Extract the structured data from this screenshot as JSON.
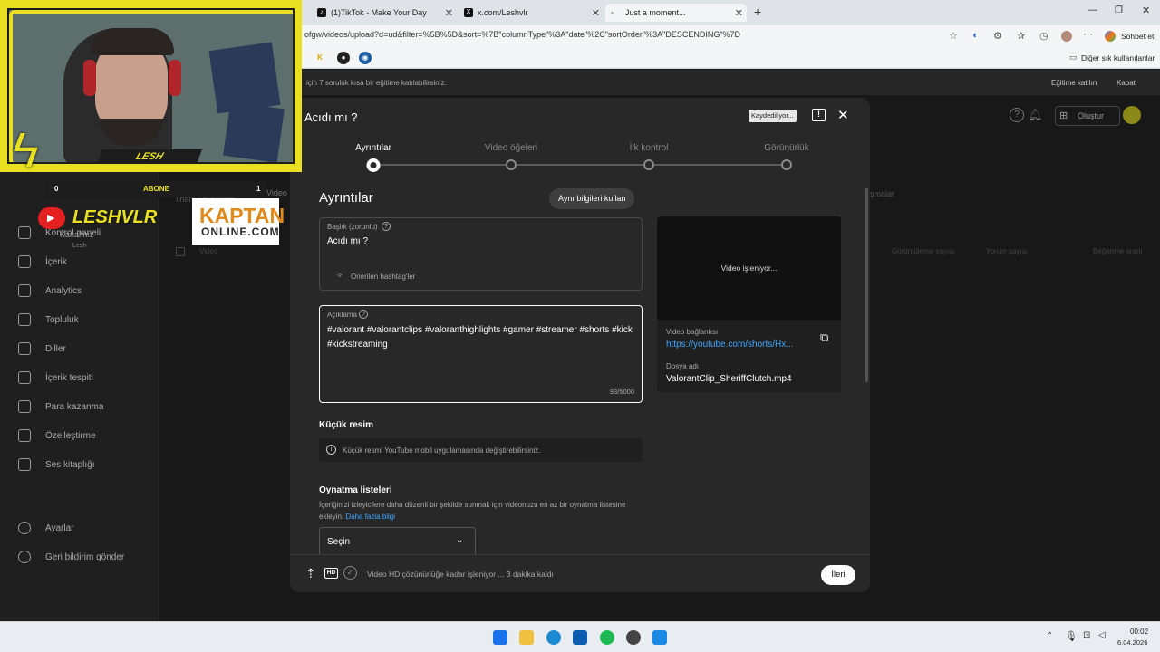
{
  "browser": {
    "tabs": [
      {
        "label": "(1)TikTok - Make Your Day"
      },
      {
        "label": "x.com/Leshvlr"
      },
      {
        "label": "Just a moment..."
      }
    ],
    "url": "ofgw/videos/upload?d=ud&filter=%5B%5D&sort=%7B\"columnType\"%3A\"date\"%2C\"sortOrder\"%3A\"DESCENDING\"%7D",
    "copilot_label": "Sohbet et",
    "bookmarks_other": "Diğer sık kullanılanlar"
  },
  "banner": {
    "text": "için 7 soruluk kısa bir eğitime katılabilirsiniz.",
    "join": "Eğitime katılın",
    "close": "Kapat"
  },
  "header": {
    "create": "Oluştur"
  },
  "channel": {
    "label": "Kanalınız",
    "name": "Lesh"
  },
  "sidebar": {
    "items": [
      {
        "label": "Kontrol paneli",
        "icon": "dashboard-icon"
      },
      {
        "label": "İçerik",
        "icon": "content-icon"
      },
      {
        "label": "Analytics",
        "icon": "analytics-icon"
      },
      {
        "label": "Topluluk",
        "icon": "community-icon"
      },
      {
        "label": "Diller",
        "icon": "subtitles-icon"
      },
      {
        "label": "İçerik tespiti",
        "icon": "copyright-icon"
      },
      {
        "label": "Para kazanma",
        "icon": "dollar-icon"
      },
      {
        "label": "Özelleştirme",
        "icon": "magic-icon"
      },
      {
        "label": "Ses kitaplığı",
        "icon": "audio-library-icon"
      }
    ],
    "bottom": [
      {
        "label": "Ayarlar",
        "icon": "gear-icon"
      },
      {
        "label": "Geri bildirim gönder",
        "icon": "feedback-icon"
      }
    ]
  },
  "page_bg": {
    "tab_video": "Video",
    "tab_inspiration": "İlham kaynakları",
    "col_playlists": "işmalar",
    "col_views": "Görüntüleme sayısı",
    "col_comments": "Yorum sayısı",
    "col_likes": "Beğenme oranı",
    "video_label": "Video"
  },
  "modal": {
    "title": "Acıdı mı ?",
    "saving": "Kaydediliyor...",
    "steps": [
      "Ayrıntılar",
      "Video öğeleri",
      "İlk kontrol",
      "Görünürlük"
    ],
    "section_title": "Ayrıntılar",
    "reuse_button": "Aynı bilgileri kullan",
    "title_field": {
      "label": "Başlık (zorunlu)",
      "value": "Acıdı mı ?",
      "hashtags": "Önerilen hashtag'ler"
    },
    "desc_field": {
      "label": "Açıklama",
      "value": "#valorant #valorantclips #valoranthighlights #gamer #streamer #shorts #kick #kickstreaming",
      "counter": "93/5000"
    },
    "preview": {
      "processing": "Video işleniyor...",
      "link_label": "Video bağlantısı",
      "link": "https://youtube.com/shorts/Hx...",
      "file_label": "Dosya adı",
      "file": "ValorantClip_SheriffClutch.mp4"
    },
    "thumbnail": {
      "title": "Küçük resim",
      "note": "Küçük resmi YouTube mobil uygulamasında değiştirebilirsiniz."
    },
    "playlists": {
      "title": "Oynatma listeleri",
      "desc": "İçeriğinizi izleyicilere daha düzenli bir şekilde sunmak için videonuzu en az bir oynatma listesine ekleyin.",
      "link": "Daha fazla bilgi",
      "select": "Seçin"
    },
    "footer": {
      "status": "Video HD çözünürlüğe kadar işleniyor ... 3 dakika kaldı",
      "hd": "HD",
      "next": "İleri"
    }
  },
  "overlay": {
    "streamer": "LESH",
    "subs_count": "0",
    "subs_label": "ABONE",
    "subs_target": "1",
    "brand": "LESHVLR",
    "sponsor": "KAPTAN",
    "sponsor_sub": "ONLINE.COM"
  },
  "taskbar": {
    "time": "00:02",
    "date": "6.04.2026"
  },
  "colors": {
    "accent": "#3ea6ff",
    "overlay_yellow": "#e8e021"
  }
}
